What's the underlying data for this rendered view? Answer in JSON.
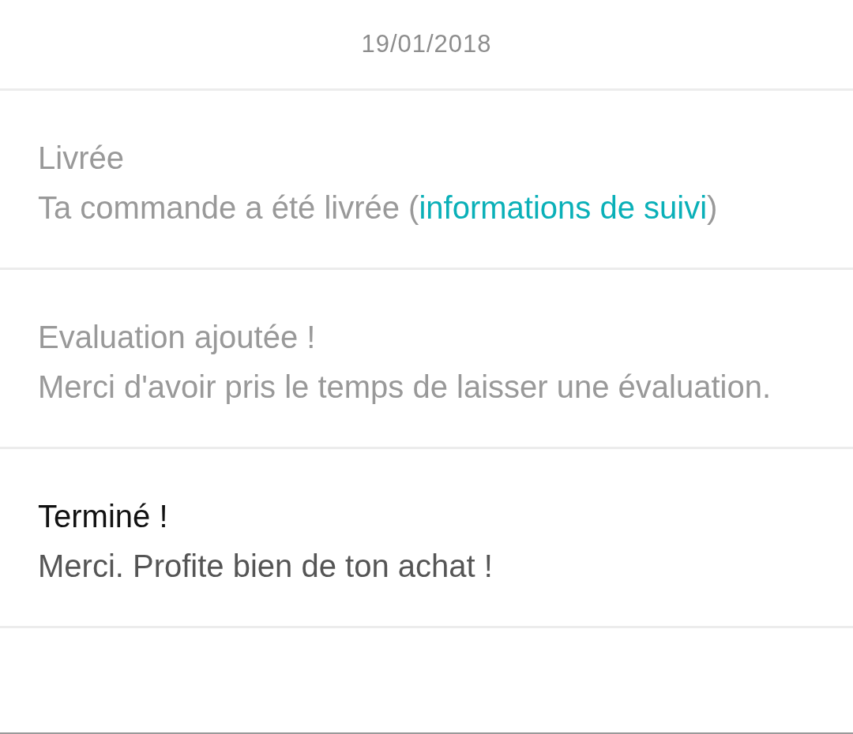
{
  "date": "19/01/2018",
  "events": [
    {
      "title": "Livrée",
      "active": false,
      "body": [
        {
          "kind": "text",
          "text": "Ta commande a été livrée ("
        },
        {
          "kind": "link",
          "text": "informations de suivi"
        },
        {
          "kind": "text",
          "text": ")"
        }
      ]
    },
    {
      "title": "Evaluation ajoutée !",
      "active": false,
      "body": [
        {
          "kind": "text",
          "text": "Merci d'avoir pris le temps de laisser une évaluation."
        }
      ]
    },
    {
      "title": "Terminé !",
      "active": true,
      "body": [
        {
          "kind": "text",
          "text": "Merci. Profite bien de ton achat !"
        }
      ]
    }
  ]
}
